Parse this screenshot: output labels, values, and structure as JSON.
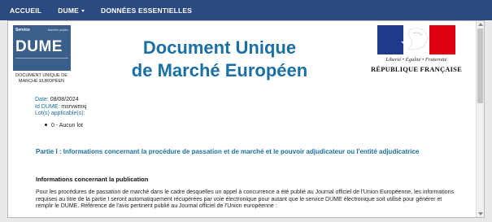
{
  "nav": {
    "items": [
      {
        "label": "ACCUEIL"
      },
      {
        "label": "DUME"
      },
      {
        "label": "DONNÉES ESSENTIELLES"
      }
    ]
  },
  "dume_logo": {
    "service": "Service",
    "name": "DUME",
    "tagline": "Marchés publics",
    "caption": "DOCUMENT UNIQUE DE MARCHÉ EUROPÉEN"
  },
  "title": {
    "line1": "Document Unique",
    "line2": "de Marché Européen"
  },
  "republic": {
    "motto": "Liberté • Égalité • Fraternité",
    "name": "RÉPUBLIQUE FRANÇAISE"
  },
  "meta": {
    "date_label": "Date:",
    "date_value": "08/08/2024",
    "id_label": "Id DUME:",
    "id_value": "msrvwmxj",
    "lots_label": "Lot(s) applicable(s):",
    "lot_item": "0 - Aucun lot"
  },
  "content": {
    "part_heading": "Partie I : Informations concernant la procédure de passation et de marché et le pouvoir adjudicateur ou l'entité adjudicatrice",
    "sub_heading": "Informations concernant la publication",
    "paragraph": "Pour les procédures de passation de marché dans le cadre desquelles un appel à concurrence a été publié au Journal officiel de l'Union Européenne, les informations requises au titre de la partie I seront automatiquement récupérées par voie électronique pour autant que le service DUME électronique soit utilisé pour générer et remplir le DUME. Référence de l'avis pertinent publié au Journal officiel de l'Union européenne :"
  },
  "colors": {
    "navbar": "#2b4a7f",
    "accent_blue": "#1a6fa3",
    "flag_blue": "#1f3a8c",
    "flag_red": "#e1000f",
    "dume_logo_bg": "#3a5f8a"
  }
}
